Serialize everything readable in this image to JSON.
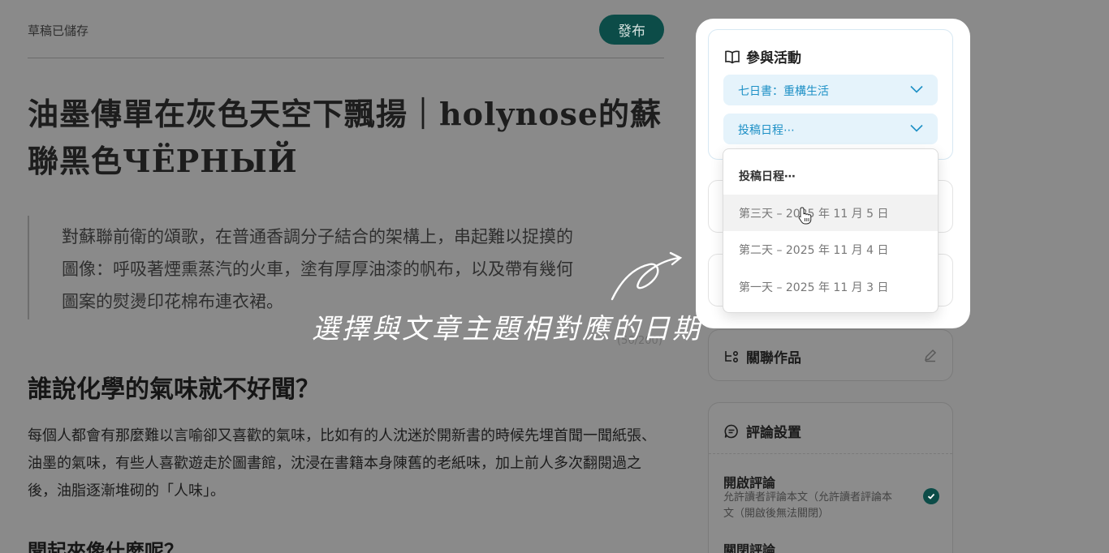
{
  "editor": {
    "draft_status": "草稿已儲存",
    "publish_label": "發布",
    "title": "油墨傳單在灰色天空下飄揚｜holynose的蘇聯黑色ЧЁРНЫЙ",
    "summary": "對蘇聯前衛的頌歌，在普通香調分子結合的架構上，串起難以捉摸的圖像：呼吸著煙熏蒸汽的火車，塗有厚厚油漆的帆布，以及帶有幾何圖案的熨燙印花棉布連衣裙。",
    "summary_count": "(56/200)",
    "section_heading": "誰說化學的氣味就不好聞？",
    "body": "每個人都會有那麼難以言喻卻又喜歡的氣味，比如有的人沈迷於開新書的時候先埋首聞一聞紙張、油墨的氣味，有些人喜歡遊走於圖書館，沈浸在書籍本身陳舊的老紙味，加上前人多次翻閱過之後，油脂逐漸堆砌的「人味」。",
    "section_heading_2": "聞起來像什麼呢？"
  },
  "sidebar": {
    "event": {
      "title": "參與活動",
      "event_select": "七日書：重構生活",
      "schedule_select": "投稿日程⋯",
      "icon": "book-open-icon"
    },
    "schedule_dropdown": {
      "header": "投稿日程⋯",
      "options": [
        "第三天 – 2025 年 11 月 5 日",
        "第二天 – 2025 年 11 月 4 日",
        "第一天 – 2025 年 11 月 3 日"
      ],
      "hovered_index": 0
    },
    "related_works": {
      "title": "關聯作品",
      "icon": "connection-icon",
      "edit_icon": "pencil-icon"
    },
    "comments": {
      "title": "評論設置",
      "icon": "chat-bubble-icon",
      "enable_title": "開啟評論",
      "enable_desc": "允許讀者評論本文（允許讀者評論本文（開啟後無法關閉）",
      "disable_title": "關閉評論"
    }
  },
  "annotation": {
    "text": "選擇與文章主題相對應的日期"
  },
  "colors": {
    "accent": "#0c4c48",
    "link_blue": "#1d90c6",
    "select_bg": "#e5f3fb"
  }
}
